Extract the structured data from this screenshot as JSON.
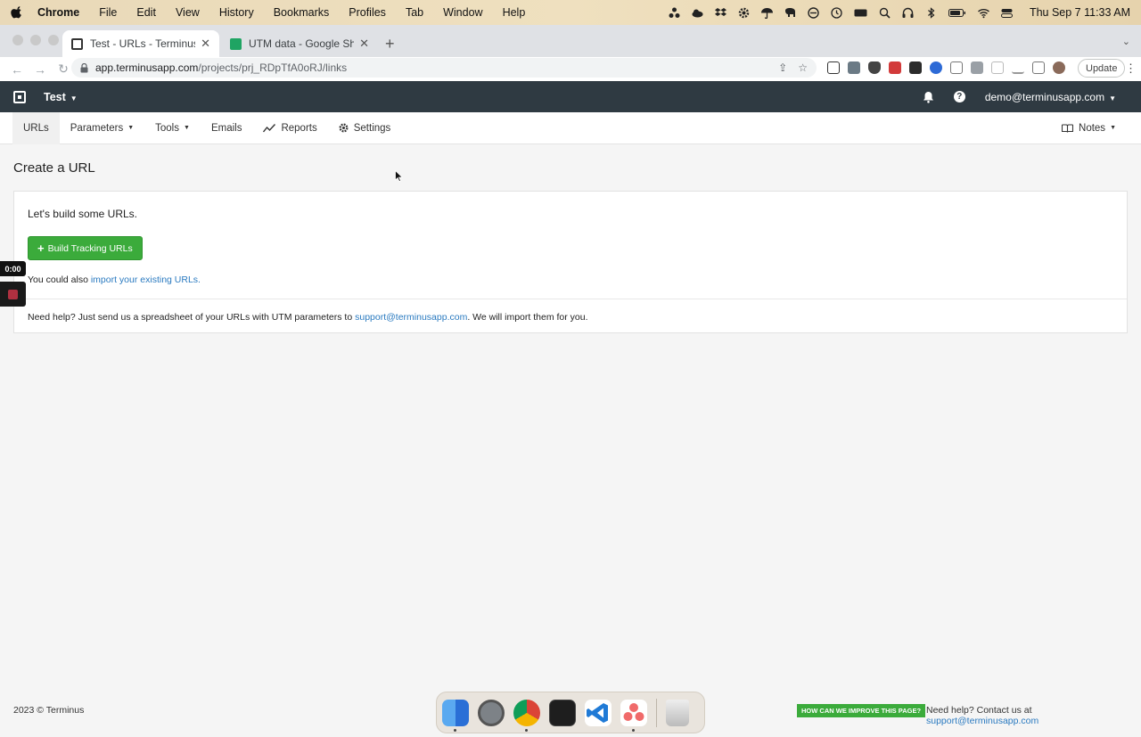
{
  "menubar": {
    "app": "Chrome",
    "items": [
      "File",
      "Edit",
      "View",
      "History",
      "Bookmarks",
      "Profiles",
      "Tab",
      "Window",
      "Help"
    ],
    "clock": "Thu Sep 7  11:33 AM"
  },
  "browser": {
    "tabs": [
      {
        "title": "Test - URLs - TerminusTest - C",
        "active": true
      },
      {
        "title": "UTM data - Google Sheets",
        "active": false
      }
    ],
    "url_host": "app.terminusapp.com",
    "url_path": "/projects/prj_RDpTfA0oRJ/links",
    "update_label": "Update"
  },
  "app": {
    "project": "Test",
    "user_email": "demo@terminusapp.com"
  },
  "subnav": {
    "items": [
      {
        "label": "URLs",
        "active": true
      },
      {
        "label": "Parameters",
        "dropdown": true
      },
      {
        "label": "Tools",
        "dropdown": true
      },
      {
        "label": "Emails"
      },
      {
        "label": "Reports",
        "icon": "chart-line-icon"
      },
      {
        "label": "Settings",
        "icon": "gear-icon"
      }
    ],
    "notes": "Notes"
  },
  "main": {
    "title": "Create a URL",
    "intro": "Let's build some URLs.",
    "build_button": "Build Tracking URLs",
    "import_prefix": "You could also ",
    "import_link": "import your existing URLs.",
    "help_prefix": "Need help? Just send us a spreadsheet of your URLs with UTM parameters to ",
    "help_email": "support@terminusapp.com",
    "help_suffix": ". We will import them for you."
  },
  "recorder": {
    "timer": "0:00"
  },
  "footer": {
    "copyright": "2023 © Terminus",
    "feedback": "HOW CAN WE IMPROVE THIS PAGE?",
    "contact_prefix": "Need help? Contact us at ",
    "contact_email": "support@terminusapp.com"
  },
  "colors": {
    "accent_green": "#3bab3b",
    "header_dark": "#2f3a42",
    "link_blue": "#2a7ac0"
  }
}
